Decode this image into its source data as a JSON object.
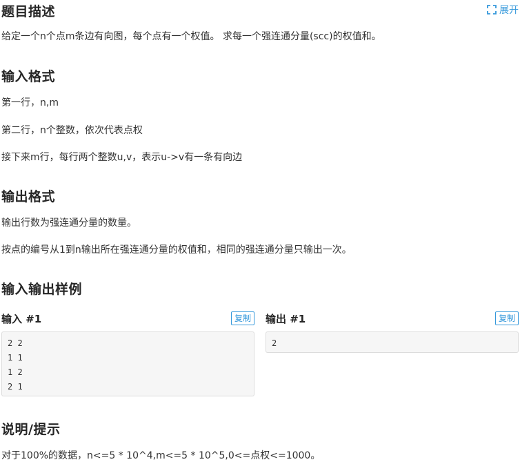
{
  "header": {
    "title": "题目描述",
    "expand_label": "展开"
  },
  "description": {
    "text": "给定一个n个点m条边有向图，每个点有一个权值。 求每一个强连通分量(scc)的权值和。"
  },
  "input_format": {
    "title": "输入格式",
    "lines": [
      "第一行，n,m",
      "第二行，n个整数，依次代表点权",
      "接下来m行，每行两个整数u,v，表示u->v有一条有向边"
    ]
  },
  "output_format": {
    "title": "输出格式",
    "lines": [
      "输出行数为强连通分量的数量。",
      "按点的编号从1到n输出所在强连通分量的权值和，相同的强连通分量只输出一次。"
    ]
  },
  "samples": {
    "title": "输入输出样例",
    "input": {
      "title": "输入 #1",
      "copy_label": "复制",
      "lines": [
        "2 2",
        "1 1",
        "1 2",
        "2 1"
      ]
    },
    "output": {
      "title": "输出 #1",
      "copy_label": "复制",
      "lines": [
        "2"
      ]
    }
  },
  "hint": {
    "title": "说明/提示",
    "text": "对于100%的数据，n<=5 * 10^4,m<=5 * 10^5,0<=点权<=1000。"
  },
  "colors": {
    "accent": "#3498db",
    "code_bg": "#f6f6f6",
    "code_border": "#dcdcdc"
  }
}
